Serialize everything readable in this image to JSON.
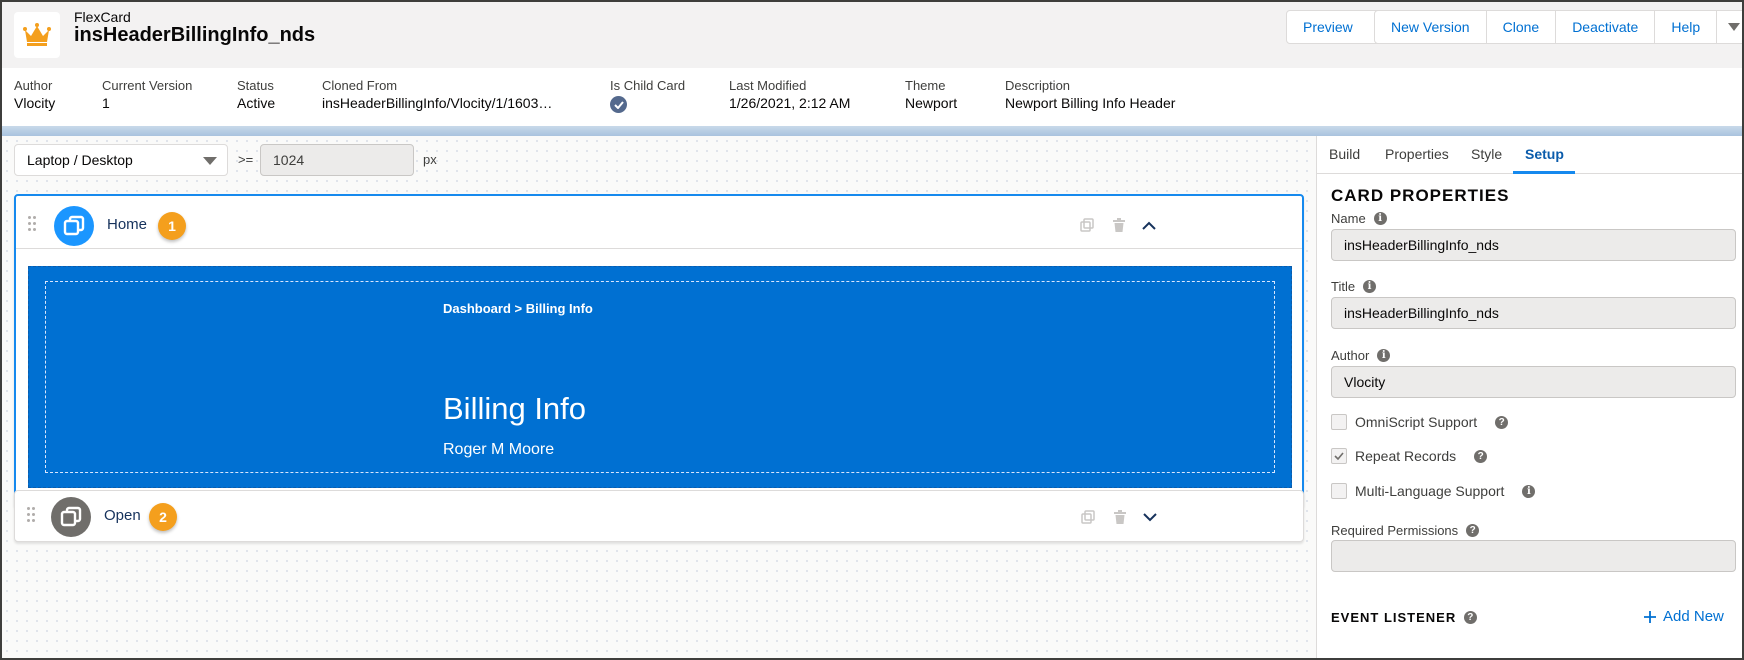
{
  "header": {
    "kind": "FlexCard",
    "title": "insHeaderBillingInfo_nds",
    "buttons": [
      "Preview",
      "New Version",
      "Clone",
      "Deactivate",
      "Help"
    ],
    "logo_icon": "crown-icon"
  },
  "meta": {
    "author": {
      "label": "Author",
      "value": "Vlocity"
    },
    "version": {
      "label": "Current Version",
      "value": "1"
    },
    "status": {
      "label": "Status",
      "value": "Active"
    },
    "cloned": {
      "label": "Cloned From",
      "value": "insHeaderBillingInfo/Vlocity/1/1603…"
    },
    "child": {
      "label": "Is Child Card",
      "value": true
    },
    "modified": {
      "label": "Last Modified",
      "value": "1/26/2021, 2:12 AM"
    },
    "theme": {
      "label": "Theme",
      "value": "Newport"
    },
    "description": {
      "label": "Description",
      "value": "Newport Billing Info Header"
    }
  },
  "canvas": {
    "device": "Laptop / Desktop",
    "ge": ">=",
    "width": "1024",
    "unit": "px",
    "states": [
      {
        "name": "Home",
        "badge": "1",
        "expanded": true,
        "preview": {
          "breadcrumb": "Dashboard > Billing Info",
          "title": "Billing Info",
          "name": "Roger M Moore"
        }
      },
      {
        "name": "Open",
        "badge": "2",
        "expanded": false
      }
    ]
  },
  "panel": {
    "tabs": [
      "Build",
      "Properties",
      "Style",
      "Setup"
    ],
    "active_tab": "Setup",
    "section_title": "CARD PROPERTIES",
    "fields": {
      "name": {
        "label": "Name",
        "value": "insHeaderBillingInfo_nds"
      },
      "title": {
        "label": "Title",
        "value": "insHeaderBillingInfo_nds"
      },
      "author": {
        "label": "Author",
        "value": "Vlocity"
      }
    },
    "checkboxes": [
      {
        "label": "OmniScript Support",
        "checked": false,
        "hint": "help"
      },
      {
        "label": "Repeat Records",
        "checked": true,
        "hint": "help"
      },
      {
        "label": "Multi-Language Support",
        "checked": false,
        "hint": "info"
      }
    ],
    "permissions": {
      "label": "Required Permissions",
      "value": ""
    },
    "event_listener": {
      "title": "EVENT LISTENER",
      "add_label": "Add New"
    }
  },
  "colors": {
    "brand": "#0070d2",
    "badge": "#f49f1d",
    "state_home": "#1b96ff",
    "state_open": "#706e6b"
  }
}
